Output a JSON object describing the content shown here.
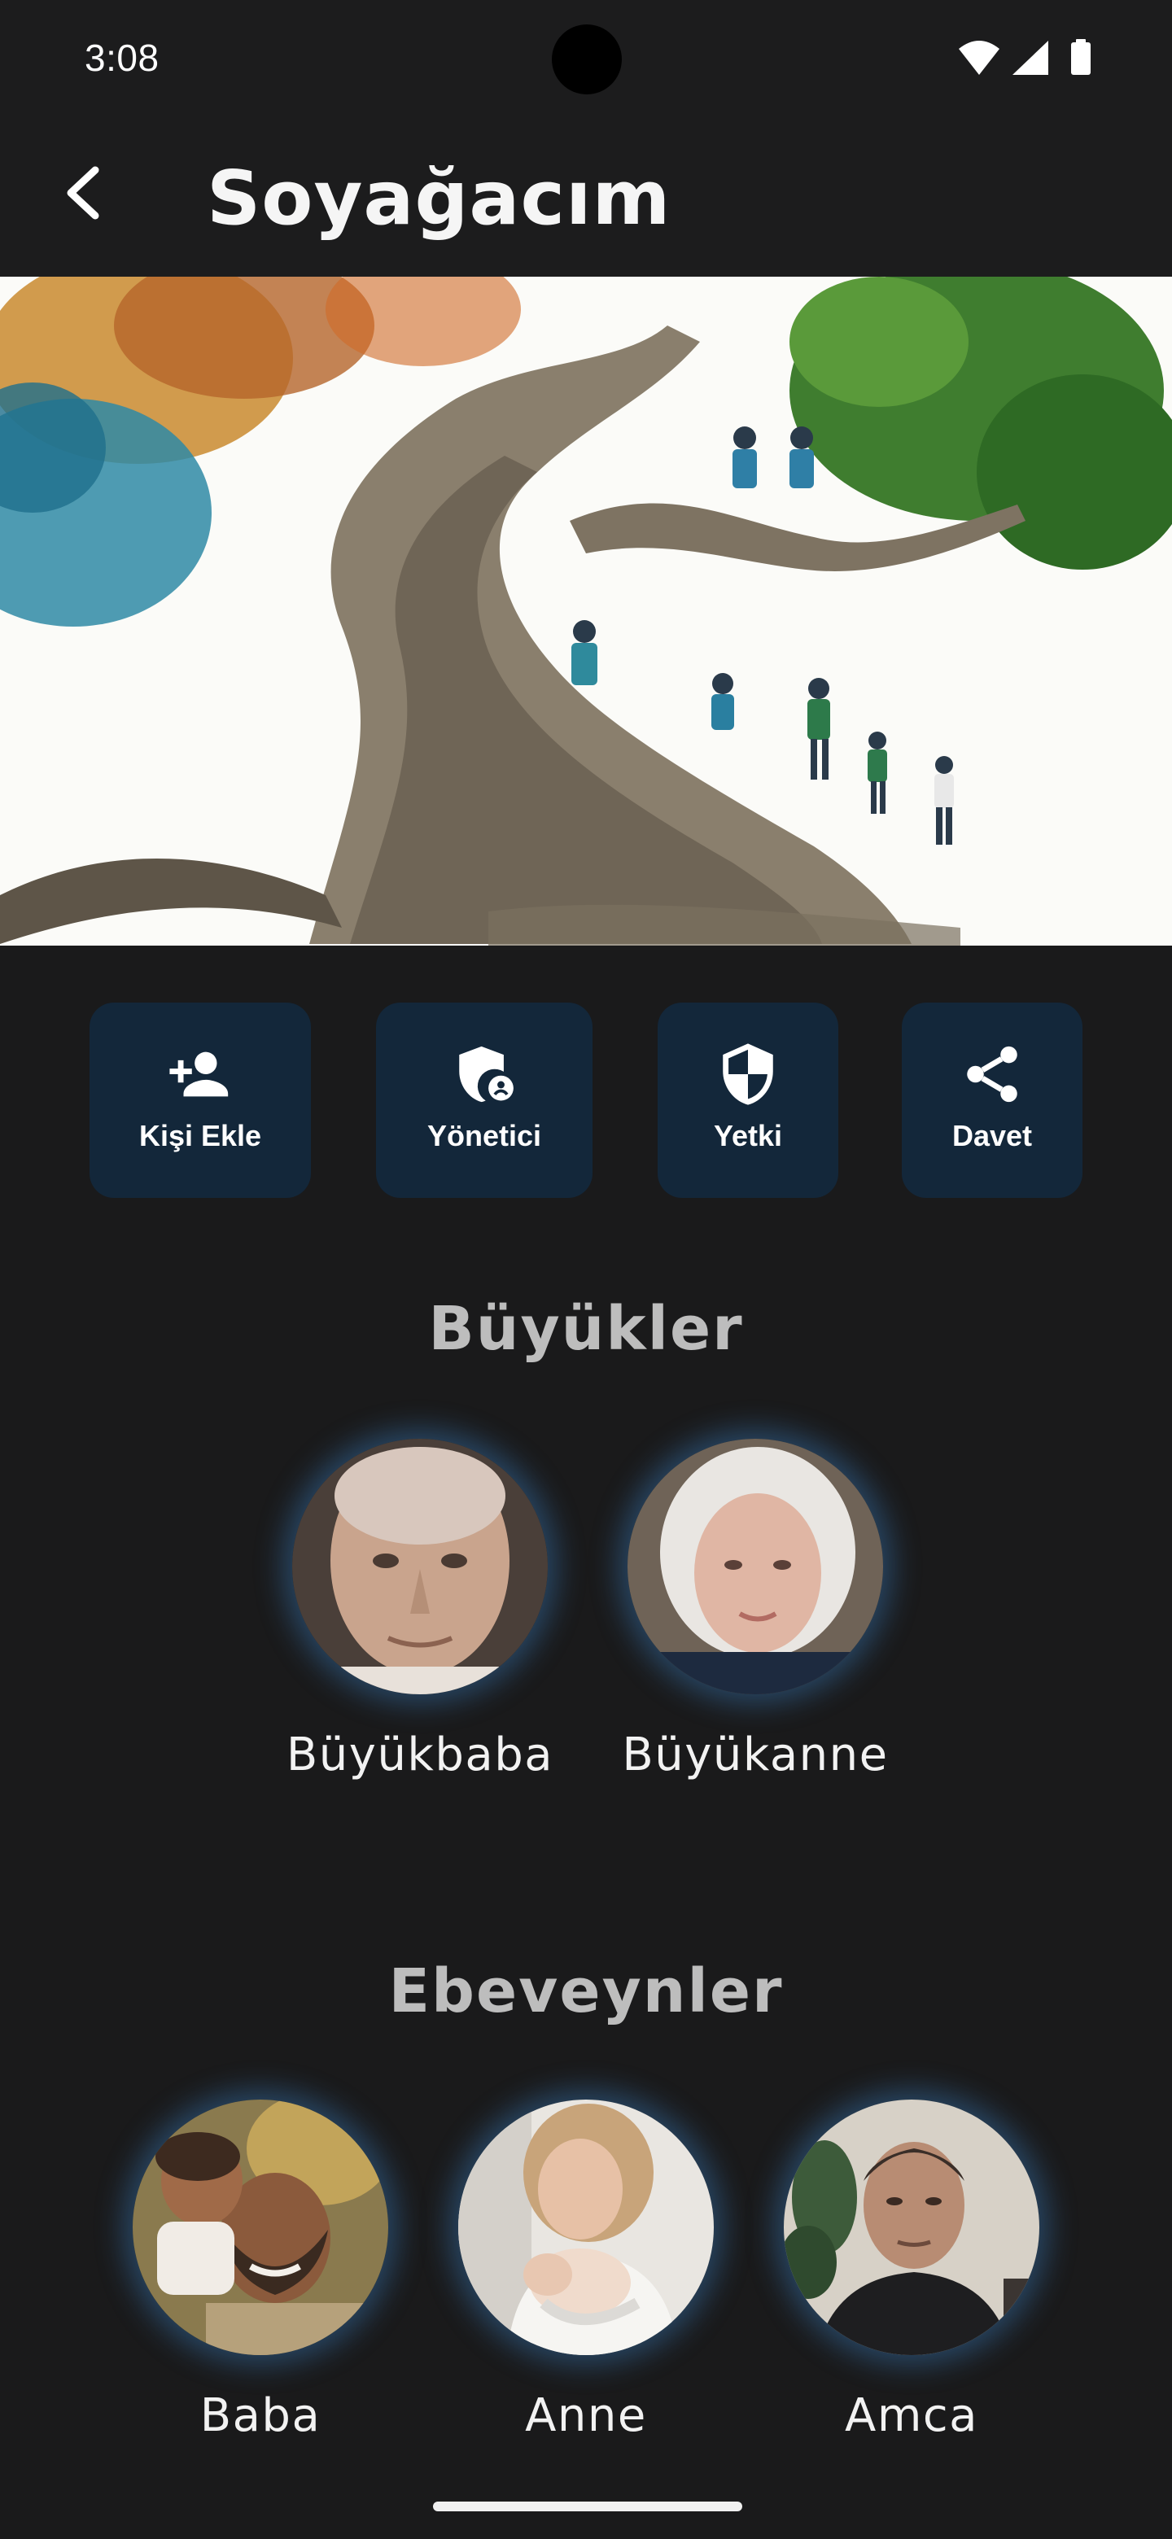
{
  "status_bar": {
    "time": "3:08"
  },
  "app_bar": {
    "title": "Soyağacım",
    "back_icon": "arrow-back-icon"
  },
  "hero": {
    "alt": "family-tree-illustration"
  },
  "actions": [
    {
      "label": "Kişi Ekle",
      "icon": "person-add-icon"
    },
    {
      "label": "Yönetici",
      "icon": "admin-shield-icon"
    },
    {
      "label": "Yetki",
      "icon": "shield-icon"
    },
    {
      "label": "Davet",
      "icon": "share-icon"
    }
  ],
  "sections": {
    "grandparents": {
      "title": "Büyükler",
      "people": [
        {
          "name": "Büyükbaba"
        },
        {
          "name": "Büyükanne"
        }
      ]
    },
    "parents": {
      "title": "Ebeveynler",
      "people": [
        {
          "name": "Baba"
        },
        {
          "name": "Anne"
        },
        {
          "name": "Amca"
        }
      ]
    }
  },
  "colors": {
    "background": "#1a1a1b",
    "button_bg": "#13273a",
    "section_title": "#bdbdbd",
    "avatar_glow": "#3c82c8"
  }
}
